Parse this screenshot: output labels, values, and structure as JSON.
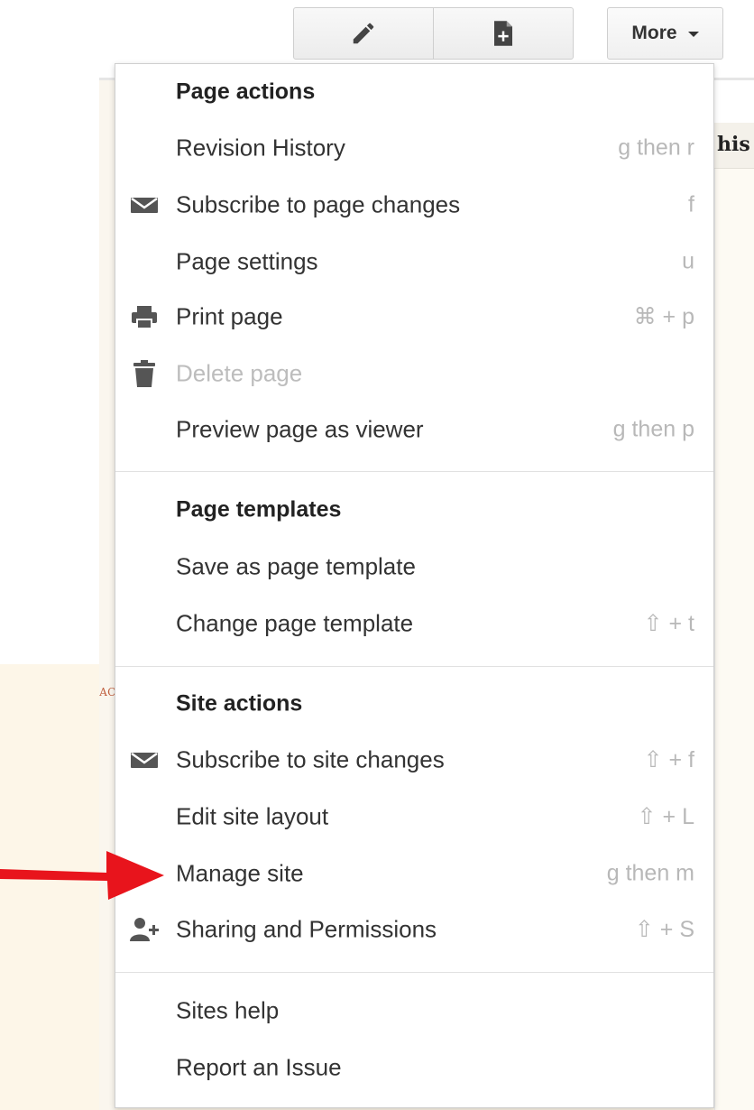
{
  "toolbar": {
    "edit_icon": "pencil-icon",
    "new_page_icon": "new-page-icon",
    "more_label": "More"
  },
  "background": {
    "right_tab_text": "his",
    "left_glyph": "АC"
  },
  "menu": {
    "page_actions": {
      "heading": "Page actions",
      "items": [
        {
          "label": "Revision History",
          "shortcut": "g then r",
          "icon": ""
        },
        {
          "label": "Subscribe to page changes",
          "shortcut": "f",
          "icon": "envelope-icon"
        },
        {
          "label": "Page settings",
          "shortcut": "u",
          "icon": ""
        },
        {
          "label": "Print page",
          "shortcut": "⌘ + p",
          "icon": "printer-icon"
        },
        {
          "label": "Delete page",
          "shortcut": "",
          "icon": "trash-icon",
          "disabled": true
        },
        {
          "label": "Preview page as viewer",
          "shortcut": "g then p",
          "icon": ""
        }
      ]
    },
    "page_templates": {
      "heading": "Page templates",
      "items": [
        {
          "label": "Save as page template",
          "shortcut": ""
        },
        {
          "label": "Change page template",
          "shortcut": "⇧ + t"
        }
      ]
    },
    "site_actions": {
      "heading": "Site actions",
      "items": [
        {
          "label": "Subscribe to site changes",
          "shortcut": "⇧ + f",
          "icon": "envelope-icon"
        },
        {
          "label": "Edit site layout",
          "shortcut": "⇧ + L",
          "icon": ""
        },
        {
          "label": "Manage site",
          "shortcut": "g then m",
          "icon": ""
        },
        {
          "label": "Sharing and Permissions",
          "shortcut": "⇧ + S",
          "icon": "add-person-icon"
        }
      ]
    },
    "help": {
      "items": [
        {
          "label": "Sites help",
          "shortcut": ""
        },
        {
          "label": "Report an Issue",
          "shortcut": ""
        }
      ]
    }
  },
  "annotation": {
    "arrow_color": "#e8141c",
    "arrow_target": "Manage site"
  }
}
